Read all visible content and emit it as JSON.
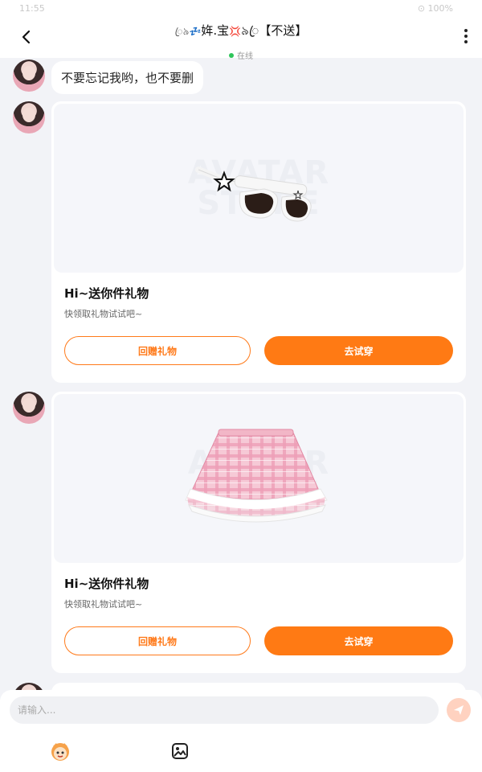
{
  "status_bar": {
    "time": "11:55",
    "right": "⊙ 100%"
  },
  "header": {
    "title_prefix": "ꦿ৯",
    "title_zz": "💤",
    "title_name": "姩.宝",
    "title_anger": "💢",
    "title_suffix": "৯ꦿ【不送】",
    "online_label": "在线"
  },
  "messages": [
    {
      "type": "text",
      "text": "不要忘记我哟，也不要删"
    },
    {
      "type": "gift_card",
      "item": "sunglasses",
      "watermark": "AVATAR STORE",
      "title": "Hi~送你件礼物",
      "subtitle": "快领取礼物试试吧~",
      "return_gift_label": "回赠礼物",
      "try_on_label": "去试穿"
    },
    {
      "type": "gift_card",
      "item": "pink plaid skirt",
      "watermark": "AVATAR STORE",
      "title": "Hi~送你件礼物",
      "subtitle": "快领取礼物试试吧~",
      "return_gift_label": "回赠礼物",
      "try_on_label": "去试穿"
    }
  ],
  "composer": {
    "placeholder": "请输入..."
  },
  "icons": {
    "back": "chevron-left-icon",
    "more": "more-vertical-icon",
    "send": "send-icon",
    "emoji": "avatar-emoji-icon",
    "image": "image-icon"
  },
  "colors": {
    "accent": "#ff7a14",
    "online": "#2ec55a",
    "background": "#f2f3f7"
  }
}
